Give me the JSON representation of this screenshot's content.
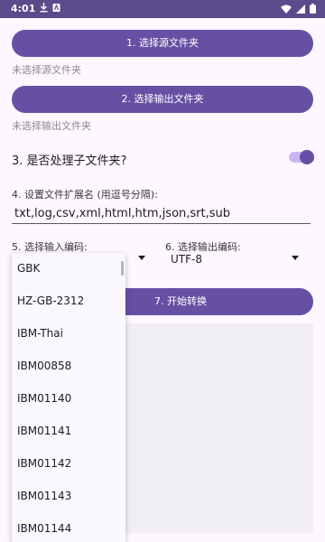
{
  "status_bar": {
    "time": "4:01",
    "icons": [
      "download-icon",
      "text-app-icon",
      "wifi-icon",
      "signal-icon",
      "battery-icon"
    ]
  },
  "source": {
    "button_label": "1. 选择源文件夹",
    "status": "未选择源文件夹"
  },
  "output": {
    "button_label": "2. 选择输出文件夹",
    "status": "未选择输出文件夹"
  },
  "subfolders": {
    "label": "3. 是否处理子文件夹?",
    "enabled": true
  },
  "extensions": {
    "label": "4. 设置文件扩展名 (用逗号分隔):",
    "value": "txt,log,csv,xml,html,htm,json,srt,sub"
  },
  "input_encoding": {
    "label": "5. 选择输入编码:"
  },
  "output_encoding": {
    "label": "6. 选择输出编码:",
    "value": "UTF-8"
  },
  "convert": {
    "button_label": "7. 开始转换"
  },
  "dropdown": {
    "options": [
      "GBK",
      "HZ-GB-2312",
      "IBM-Thai",
      "IBM00858",
      "IBM01140",
      "IBM01141",
      "IBM01142",
      "IBM01143",
      "IBM01144"
    ]
  },
  "colors": {
    "primary": "#6750a4",
    "status_bar": "#5b4a8c",
    "background": "#fdf7ff"
  }
}
